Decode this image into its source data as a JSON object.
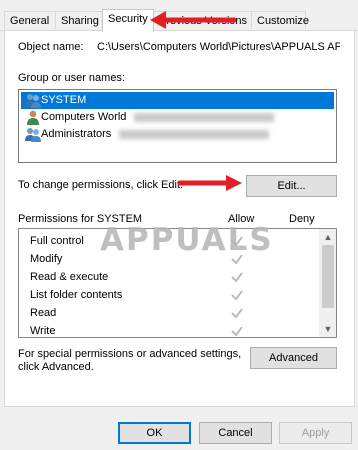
{
  "tabs": [
    {
      "label": "General",
      "active": false
    },
    {
      "label": "Sharing",
      "active": false
    },
    {
      "label": "Security",
      "active": true
    },
    {
      "label": "Previous Versions",
      "active": false
    },
    {
      "label": "Customize",
      "active": false
    }
  ],
  "object_name": {
    "label": "Object name:",
    "value": "C:\\Users\\Computers World\\Pictures\\APPUALS AF"
  },
  "groups": {
    "label": "Group or user names:",
    "items": [
      {
        "name": "SYSTEM",
        "selected": true,
        "icon": "users-group-icon"
      },
      {
        "name": "Computers World",
        "selected": false,
        "icon": "user-icon"
      },
      {
        "name": "Administrators",
        "selected": false,
        "icon": "users-group-icon"
      }
    ]
  },
  "change_permissions": {
    "text": "To change permissions, click Edit.",
    "edit_label": "Edit..."
  },
  "permissions": {
    "header": "Permissions for SYSTEM",
    "allow_label": "Allow",
    "deny_label": "Deny",
    "rows": [
      {
        "name": "Full control",
        "allow": true,
        "deny": false
      },
      {
        "name": "Modify",
        "allow": true,
        "deny": false
      },
      {
        "name": "Read & execute",
        "allow": true,
        "deny": false
      },
      {
        "name": "List folder contents",
        "allow": true,
        "deny": false
      },
      {
        "name": "Read",
        "allow": true,
        "deny": false
      },
      {
        "name": "Write",
        "allow": true,
        "deny": false
      }
    ]
  },
  "advanced": {
    "line1": "For special permissions or advanced settings,",
    "line2": "click Advanced.",
    "button_label": "Advanced"
  },
  "footer": {
    "ok_label": "OK",
    "cancel_label": "Cancel",
    "apply_label": "Apply"
  },
  "watermark": {
    "text": "APPUALS"
  },
  "colors": {
    "selection": "#0078d7",
    "annotation_arrow": "#e41e26",
    "check_disabled": "#b5b5b5"
  }
}
